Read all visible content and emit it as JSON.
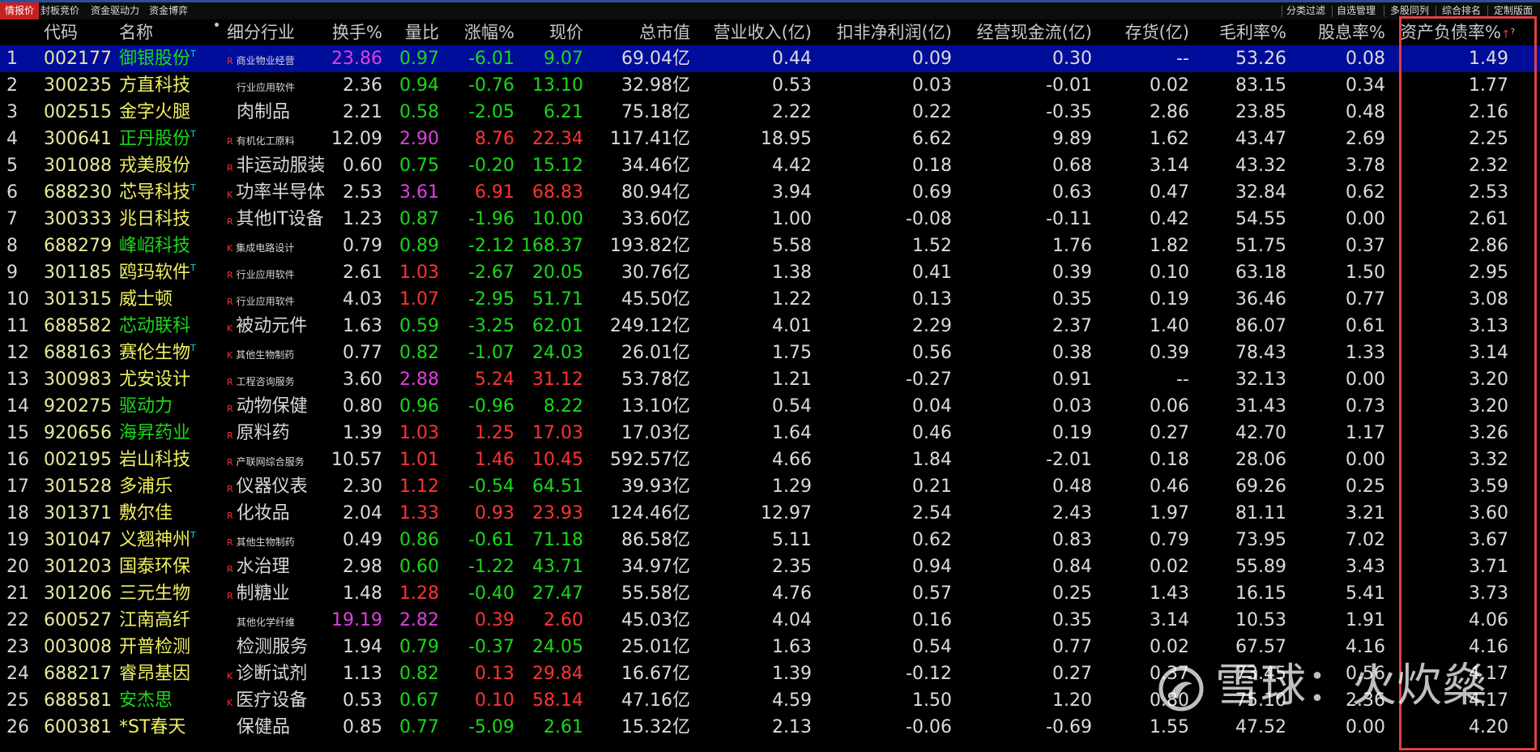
{
  "tabs": [
    "情报价",
    "封板竞价",
    "资金驱动力",
    "资金博弈"
  ],
  "right_tabs": [
    "分类过滤",
    "自选管理",
    "多股同列",
    "综合排名",
    "定制版面"
  ],
  "headers": {
    "code": "代码",
    "name": "名称",
    "industry": "细分行业",
    "turnover": "换手%",
    "vol_ratio": "量比",
    "change": "涨幅%",
    "price": "现价",
    "market_cap": "总市值",
    "revenue": "营业收入(亿)",
    "net_profit": "扣非净利润(亿)",
    "cash_flow": "经营现金流(亿)",
    "inventory": "存货(亿)",
    "gross_margin": "毛利率%",
    "dividend": "股息率%",
    "debt_ratio": "资产负债率%",
    "sort_arrow": "↑",
    "help_mark": "?"
  },
  "watermark": "雪球：火炊燊",
  "rows": [
    {
      "idx": "1",
      "code": "002177",
      "name": "御银股份",
      "t": true,
      "nc": "g",
      "k": "R",
      "ind": "商业物业经营",
      "ismall": true,
      "turn": "23.86",
      "turnc": "mg",
      "vol": "0.97",
      "volc": "g",
      "chg": "-6.01",
      "chgc": "g",
      "price": "9.07",
      "pc": "g",
      "cap": "69.04亿",
      "rev": "0.44",
      "prof": "0.09",
      "cf": "0.30",
      "inv": "--",
      "gm": "53.26",
      "div": "0.08",
      "debt": "1.49"
    },
    {
      "idx": "2",
      "code": "300235",
      "name": "方直科技",
      "t": false,
      "nc": "y",
      "k": "",
      "ind": "行业应用软件",
      "ismall": true,
      "turn": "2.36",
      "turnc": "w",
      "vol": "0.94",
      "volc": "g",
      "chg": "-0.76",
      "chgc": "g",
      "price": "13.10",
      "pc": "g",
      "cap": "32.98亿",
      "rev": "0.53",
      "prof": "0.03",
      "cf": "-0.01",
      "inv": "0.02",
      "gm": "83.15",
      "div": "0.34",
      "debt": "1.77"
    },
    {
      "idx": "3",
      "code": "002515",
      "name": "金字火腿",
      "t": false,
      "nc": "y",
      "k": "",
      "ind": "肉制品",
      "ismall": false,
      "turn": "2.21",
      "turnc": "w",
      "vol": "0.58",
      "volc": "g",
      "chg": "-2.05",
      "chgc": "g",
      "price": "6.21",
      "pc": "g",
      "cap": "75.18亿",
      "rev": "2.22",
      "prof": "0.22",
      "cf": "-0.35",
      "inv": "2.86",
      "gm": "23.85",
      "div": "0.48",
      "debt": "2.16"
    },
    {
      "idx": "4",
      "code": "300641",
      "name": "正丹股份",
      "t": true,
      "nc": "g",
      "k": "R",
      "ind": "有机化工原料",
      "ismall": true,
      "turn": "12.09",
      "turnc": "w",
      "vol": "2.90",
      "volc": "mg",
      "chg": "8.76",
      "chgc": "rd",
      "price": "22.34",
      "pc": "rd",
      "cap": "117.41亿",
      "rev": "18.95",
      "prof": "6.62",
      "cf": "9.89",
      "inv": "1.62",
      "gm": "43.47",
      "div": "2.69",
      "debt": "2.25"
    },
    {
      "idx": "5",
      "code": "301088",
      "name": "戎美股份",
      "t": false,
      "nc": "y",
      "k": "R",
      "ind": "非运动服装",
      "ismall": false,
      "turn": "0.60",
      "turnc": "w",
      "vol": "0.75",
      "volc": "g",
      "chg": "-0.20",
      "chgc": "g",
      "price": "15.12",
      "pc": "g",
      "cap": "34.46亿",
      "rev": "4.42",
      "prof": "0.18",
      "cf": "0.68",
      "inv": "3.14",
      "gm": "43.32",
      "div": "3.78",
      "debt": "2.32"
    },
    {
      "idx": "6",
      "code": "688230",
      "name": "芯导科技",
      "t": true,
      "nc": "y",
      "k": "K",
      "ind": "功率半导体",
      "ismall": false,
      "turn": "2.53",
      "turnc": "w",
      "vol": "3.61",
      "volc": "mg",
      "chg": "6.91",
      "chgc": "rd",
      "price": "68.83",
      "pc": "rd",
      "cap": "80.94亿",
      "rev": "3.94",
      "prof": "0.69",
      "cf": "0.63",
      "inv": "0.47",
      "gm": "32.84",
      "div": "0.62",
      "debt": "2.53"
    },
    {
      "idx": "7",
      "code": "300333",
      "name": "兆日科技",
      "t": false,
      "nc": "y",
      "k": "R",
      "ind": "其他IT设备",
      "ismall": false,
      "turn": "1.23",
      "turnc": "w",
      "vol": "0.87",
      "volc": "g",
      "chg": "-1.96",
      "chgc": "g",
      "price": "10.00",
      "pc": "g",
      "cap": "33.60亿",
      "rev": "1.00",
      "prof": "-0.08",
      "cf": "-0.11",
      "inv": "0.42",
      "gm": "54.55",
      "div": "0.00",
      "debt": "2.61"
    },
    {
      "idx": "8",
      "code": "688279",
      "name": "峰岹科技",
      "t": false,
      "nc": "g",
      "k": "K",
      "ind": "集成电路设计",
      "ismall": true,
      "turn": "0.79",
      "turnc": "w",
      "vol": "0.89",
      "volc": "g",
      "chg": "-2.12",
      "chgc": "g",
      "price": "168.37",
      "pc": "g",
      "cap": "193.82亿",
      "rev": "5.58",
      "prof": "1.52",
      "cf": "1.76",
      "inv": "1.82",
      "gm": "51.75",
      "div": "0.37",
      "debt": "2.86"
    },
    {
      "idx": "9",
      "code": "301185",
      "name": "鸥玛软件",
      "t": true,
      "nc": "y",
      "k": "R",
      "ind": "行业应用软件",
      "ismall": true,
      "turn": "2.61",
      "turnc": "w",
      "vol": "1.03",
      "volc": "rd",
      "chg": "-2.67",
      "chgc": "g",
      "price": "20.05",
      "pc": "g",
      "cap": "30.76亿",
      "rev": "1.38",
      "prof": "0.41",
      "cf": "0.39",
      "inv": "0.10",
      "gm": "63.18",
      "div": "1.50",
      "debt": "2.95"
    },
    {
      "idx": "10",
      "code": "301315",
      "name": "威士顿",
      "t": false,
      "nc": "y",
      "k": "R",
      "ind": "行业应用软件",
      "ismall": true,
      "turn": "4.03",
      "turnc": "w",
      "vol": "1.07",
      "volc": "rd",
      "chg": "-2.95",
      "chgc": "g",
      "price": "51.71",
      "pc": "g",
      "cap": "45.50亿",
      "rev": "1.22",
      "prof": "0.13",
      "cf": "0.35",
      "inv": "0.19",
      "gm": "36.46",
      "div": "0.77",
      "debt": "3.08"
    },
    {
      "idx": "11",
      "code": "688582",
      "name": "芯动联科",
      "t": false,
      "nc": "g",
      "k": "K",
      "ind": "被动元件",
      "ismall": false,
      "turn": "1.63",
      "turnc": "w",
      "vol": "0.59",
      "volc": "g",
      "chg": "-3.25",
      "chgc": "g",
      "price": "62.01",
      "pc": "g",
      "cap": "249.12亿",
      "rev": "4.01",
      "prof": "2.29",
      "cf": "2.37",
      "inv": "1.40",
      "gm": "86.07",
      "div": "0.61",
      "debt": "3.13"
    },
    {
      "idx": "12",
      "code": "688163",
      "name": "赛伦生物",
      "t": true,
      "nc": "y",
      "k": "K",
      "ind": "其他生物制药",
      "ismall": true,
      "turn": "0.77",
      "turnc": "w",
      "vol": "0.82",
      "volc": "g",
      "chg": "-1.07",
      "chgc": "g",
      "price": "24.03",
      "pc": "g",
      "cap": "26.01亿",
      "rev": "1.75",
      "prof": "0.56",
      "cf": "0.38",
      "inv": "0.39",
      "gm": "78.43",
      "div": "1.33",
      "debt": "3.14"
    },
    {
      "idx": "13",
      "code": "300983",
      "name": "尤安设计",
      "t": false,
      "nc": "y",
      "k": "R",
      "ind": "工程咨询服务",
      "ismall": true,
      "turn": "3.60",
      "turnc": "w",
      "vol": "2.88",
      "volc": "mg",
      "chg": "5.24",
      "chgc": "rd",
      "price": "31.12",
      "pc": "rd",
      "cap": "53.78亿",
      "rev": "1.21",
      "prof": "-0.27",
      "cf": "0.91",
      "inv": "--",
      "gm": "32.13",
      "div": "0.00",
      "debt": "3.20"
    },
    {
      "idx": "14",
      "code": "920275",
      "name": "驱动力",
      "t": false,
      "nc": "g",
      "k": "R",
      "ind": "动物保健",
      "ismall": false,
      "turn": "0.80",
      "turnc": "w",
      "vol": "0.96",
      "volc": "g",
      "chg": "-0.96",
      "chgc": "g",
      "price": "8.22",
      "pc": "g",
      "cap": "13.10亿",
      "rev": "0.54",
      "prof": "0.04",
      "cf": "0.03",
      "inv": "0.06",
      "gm": "31.43",
      "div": "0.73",
      "debt": "3.20"
    },
    {
      "idx": "15",
      "code": "920656",
      "name": "海昇药业",
      "t": false,
      "nc": "g",
      "k": "R",
      "ind": "原料药",
      "ismall": false,
      "turn": "1.39",
      "turnc": "w",
      "vol": "1.03",
      "volc": "rd",
      "chg": "1.25",
      "chgc": "rd",
      "price": "17.03",
      "pc": "rd",
      "cap": "17.03亿",
      "rev": "1.64",
      "prof": "0.46",
      "cf": "0.19",
      "inv": "0.27",
      "gm": "42.70",
      "div": "1.17",
      "debt": "3.26"
    },
    {
      "idx": "16",
      "code": "002195",
      "name": "岩山科技",
      "t": false,
      "nc": "y",
      "k": "R",
      "ind": "产联网综合服务",
      "ismall": true,
      "turn": "10.57",
      "turnc": "w",
      "vol": "1.01",
      "volc": "rd",
      "chg": "1.46",
      "chgc": "rd",
      "price": "10.45",
      "pc": "rd",
      "cap": "592.57亿",
      "rev": "4.66",
      "prof": "1.84",
      "cf": "-2.01",
      "inv": "0.18",
      "gm": "28.06",
      "div": "0.00",
      "debt": "3.32"
    },
    {
      "idx": "17",
      "code": "301528",
      "name": "多浦乐",
      "t": false,
      "nc": "y",
      "k": "R",
      "ind": "仪器仪表",
      "ismall": false,
      "turn": "2.30",
      "turnc": "w",
      "vol": "1.12",
      "volc": "rd",
      "chg": "-0.54",
      "chgc": "g",
      "price": "64.51",
      "pc": "g",
      "cap": "39.93亿",
      "rev": "1.29",
      "prof": "0.21",
      "cf": "0.48",
      "inv": "0.46",
      "gm": "69.26",
      "div": "0.25",
      "debt": "3.59"
    },
    {
      "idx": "18",
      "code": "301371",
      "name": "敷尔佳",
      "t": false,
      "nc": "y",
      "k": "R",
      "ind": "化妆品",
      "ismall": false,
      "turn": "2.04",
      "turnc": "w",
      "vol": "1.33",
      "volc": "rd",
      "chg": "0.93",
      "chgc": "rd",
      "price": "23.93",
      "pc": "rd",
      "cap": "124.46亿",
      "rev": "12.97",
      "prof": "2.54",
      "cf": "2.43",
      "inv": "1.97",
      "gm": "81.11",
      "div": "3.21",
      "debt": "3.60"
    },
    {
      "idx": "19",
      "code": "301047",
      "name": "义翘神州",
      "t": true,
      "nc": "y",
      "k": "R",
      "ind": "其他生物制药",
      "ismall": true,
      "turn": "0.49",
      "turnc": "w",
      "vol": "0.86",
      "volc": "g",
      "chg": "-0.61",
      "chgc": "g",
      "price": "71.18",
      "pc": "g",
      "cap": "86.58亿",
      "rev": "5.11",
      "prof": "0.62",
      "cf": "0.83",
      "inv": "0.79",
      "gm": "73.95",
      "div": "7.02",
      "debt": "3.67"
    },
    {
      "idx": "20",
      "code": "301203",
      "name": "国泰环保",
      "t": false,
      "nc": "y",
      "k": "R",
      "ind": "水治理",
      "ismall": false,
      "turn": "2.98",
      "turnc": "w",
      "vol": "0.60",
      "volc": "g",
      "chg": "-1.22",
      "chgc": "g",
      "price": "43.71",
      "pc": "g",
      "cap": "34.97亿",
      "rev": "2.35",
      "prof": "0.94",
      "cf": "0.84",
      "inv": "0.02",
      "gm": "55.89",
      "div": "3.43",
      "debt": "3.71"
    },
    {
      "idx": "21",
      "code": "301206",
      "name": "三元生物",
      "t": false,
      "nc": "y",
      "k": "R",
      "ind": "制糖业",
      "ismall": false,
      "turn": "1.48",
      "turnc": "w",
      "vol": "1.28",
      "volc": "rd",
      "chg": "-0.40",
      "chgc": "g",
      "price": "27.47",
      "pc": "g",
      "cap": "55.58亿",
      "rev": "4.76",
      "prof": "0.57",
      "cf": "0.25",
      "inv": "1.43",
      "gm": "16.15",
      "div": "5.41",
      "debt": "3.73"
    },
    {
      "idx": "22",
      "code": "600527",
      "name": "江南高纤",
      "t": false,
      "nc": "y",
      "k": "",
      "ind": "其他化学纤维",
      "ismall": true,
      "turn": "19.19",
      "turnc": "mg",
      "vol": "2.82",
      "volc": "mg",
      "chg": "0.39",
      "chgc": "rd",
      "price": "2.60",
      "pc": "rd",
      "cap": "45.03亿",
      "rev": "4.04",
      "prof": "0.16",
      "cf": "0.35",
      "inv": "3.14",
      "gm": "10.53",
      "div": "1.91",
      "debt": "4.06"
    },
    {
      "idx": "23",
      "code": "003008",
      "name": "开普检测",
      "t": false,
      "nc": "y",
      "k": "",
      "ind": "检测服务",
      "ismall": false,
      "turn": "1.94",
      "turnc": "w",
      "vol": "0.79",
      "volc": "g",
      "chg": "-0.37",
      "chgc": "g",
      "price": "24.05",
      "pc": "g",
      "cap": "25.01亿",
      "rev": "1.63",
      "prof": "0.54",
      "cf": "0.77",
      "inv": "0.02",
      "gm": "67.57",
      "div": "4.16",
      "debt": "4.16"
    },
    {
      "idx": "24",
      "code": "688217",
      "name": "睿昂基因",
      "t": false,
      "nc": "y",
      "k": "K",
      "ind": "诊断试剂",
      "ismall": false,
      "turn": "1.13",
      "turnc": "w",
      "vol": "0.82",
      "volc": "g",
      "chg": "0.13",
      "chgc": "rd",
      "price": "29.84",
      "pc": "rd",
      "cap": "16.67亿",
      "rev": "1.39",
      "prof": "-0.12",
      "cf": "0.27",
      "inv": "0.37",
      "gm": "73.45",
      "div": "0.56",
      "debt": "4.17"
    },
    {
      "idx": "25",
      "code": "688581",
      "name": "安杰思",
      "t": false,
      "nc": "g",
      "k": "K",
      "ind": "医疗设备",
      "ismall": false,
      "turn": "0.53",
      "turnc": "w",
      "vol": "0.67",
      "volc": "g",
      "chg": "0.10",
      "chgc": "rd",
      "price": "58.14",
      "pc": "rd",
      "cap": "47.16亿",
      "rev": "4.59",
      "prof": "1.50",
      "cf": "1.20",
      "inv": "0.80",
      "gm": "75.10",
      "div": "2.36",
      "debt": "4.17"
    },
    {
      "idx": "26",
      "code": "600381",
      "name": "*ST春天",
      "t": false,
      "nc": "y",
      "k": "",
      "ind": "保健品",
      "ismall": false,
      "turn": "0.85",
      "turnc": "w",
      "vol": "0.77",
      "volc": "g",
      "chg": "-5.09",
      "chgc": "g",
      "price": "2.61",
      "pc": "g",
      "cap": "15.32亿",
      "rev": "2.13",
      "prof": "-0.06",
      "cf": "-0.69",
      "inv": "1.55",
      "gm": "47.52",
      "div": "0.00",
      "debt": "4.20"
    }
  ]
}
